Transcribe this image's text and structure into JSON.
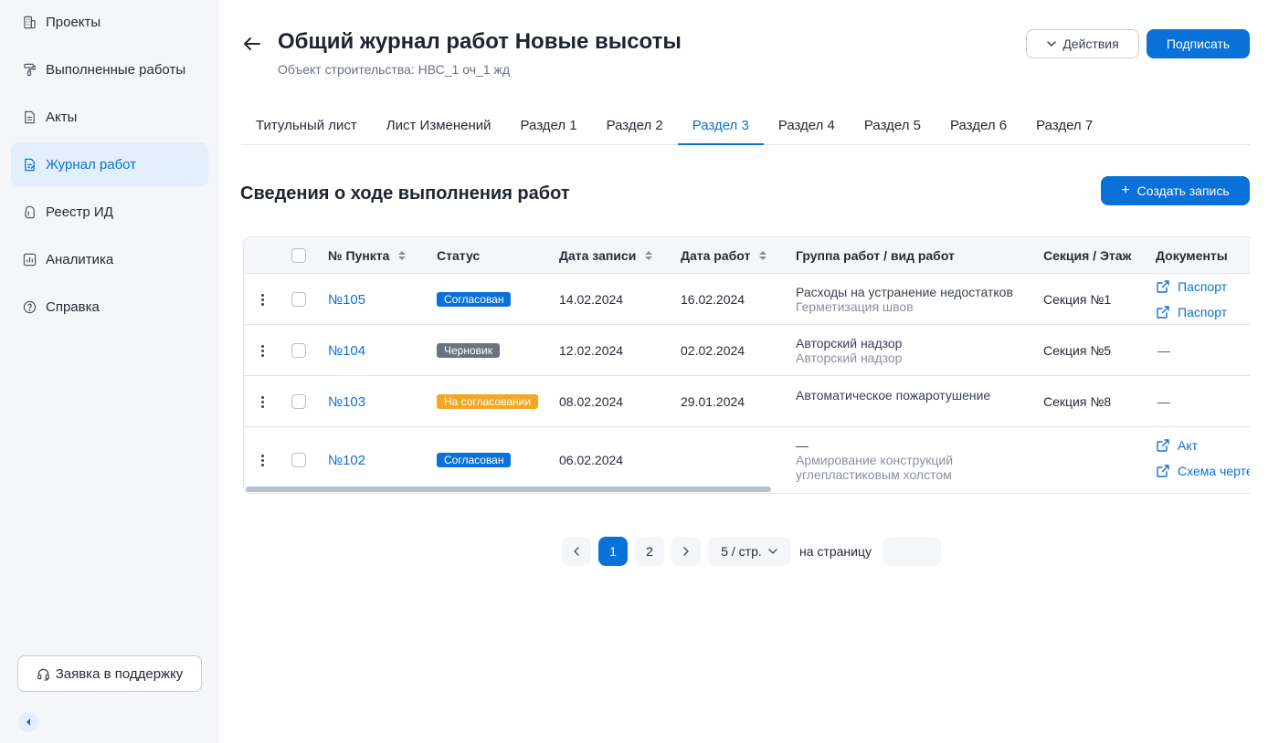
{
  "sidebar": {
    "items": [
      {
        "label": "Проекты",
        "icon": "building-icon"
      },
      {
        "label": "Выполненные работы",
        "icon": "roller-icon"
      },
      {
        "label": "Акты",
        "icon": "document-icon"
      },
      {
        "label": "Журнал работ",
        "icon": "journal-icon",
        "active": true
      },
      {
        "label": "Реестр ИД",
        "icon": "registry-icon"
      },
      {
        "label": "Аналитика",
        "icon": "chart-icon"
      },
      {
        "label": "Справка",
        "icon": "help-icon"
      }
    ],
    "support_label": "Заявка в поддержку"
  },
  "header": {
    "title": "Общий журнал работ Новые высоты",
    "subtitle": "Объект строительства: НВС_1 оч_1 жд",
    "actions_label": "Действия",
    "sign_label": "Подписать"
  },
  "tabs": [
    "Титульный лист",
    "Лист Изменений",
    "Раздел 1",
    "Раздел 2",
    "Раздел 3",
    "Раздел 4",
    "Раздел 5",
    "Раздел 6",
    "Раздел 7"
  ],
  "active_tab": "Раздел 3",
  "section": {
    "title": "Сведения о ходе выполнения работ",
    "create_label": "Создать запись",
    "create_icon": "+"
  },
  "table": {
    "columns": {
      "number": "№ Пункта",
      "status": "Статус",
      "record_date": "Дата записи",
      "work_date": "Дата работ",
      "group": "Группа работ / вид работ",
      "section": "Секция / Этаж",
      "documents": "Документы"
    },
    "rows": [
      {
        "number": "№105",
        "status": "Согласован",
        "status_color": "#0a71d8",
        "record_date": "14.02.2024",
        "work_date": "16.02.2024",
        "group": "Расходы на устранение недостатков",
        "kind": "Герметизация швов",
        "section": "Секция №1",
        "docs": [
          "Паспорт",
          "Паспорт"
        ]
      },
      {
        "number": "№104",
        "status": "Черновик",
        "status_color": "#6b7280",
        "record_date": "12.02.2024",
        "work_date": "02.02.2024",
        "group": "Авторский надзор",
        "kind": "Авторский надзор",
        "section": "Секция №5",
        "docs_placeholder": "—"
      },
      {
        "number": "№103",
        "status": "На согласовании",
        "status_color": "#f5a623",
        "record_date": "08.02.2024",
        "work_date": "29.01.2024",
        "group": "Автоматическое пожаротушение",
        "kind": "",
        "section": "Секция №8",
        "docs_placeholder": "—"
      },
      {
        "number": "№102",
        "status": "Согласован",
        "status_color": "#0a71d8",
        "record_date": "06.02.2024",
        "work_date": "",
        "group": "—",
        "kind_line1": "Армирование конструкций",
        "kind_line2": "углепластиковым холстом",
        "section": "",
        "docs": [
          "Акт",
          "Схема черте"
        ]
      }
    ]
  },
  "pagination": {
    "pages": [
      "1",
      "2"
    ],
    "current": "1",
    "page_size": "5 / стр.",
    "goto_label": "на страницу",
    "goto_value": ""
  }
}
